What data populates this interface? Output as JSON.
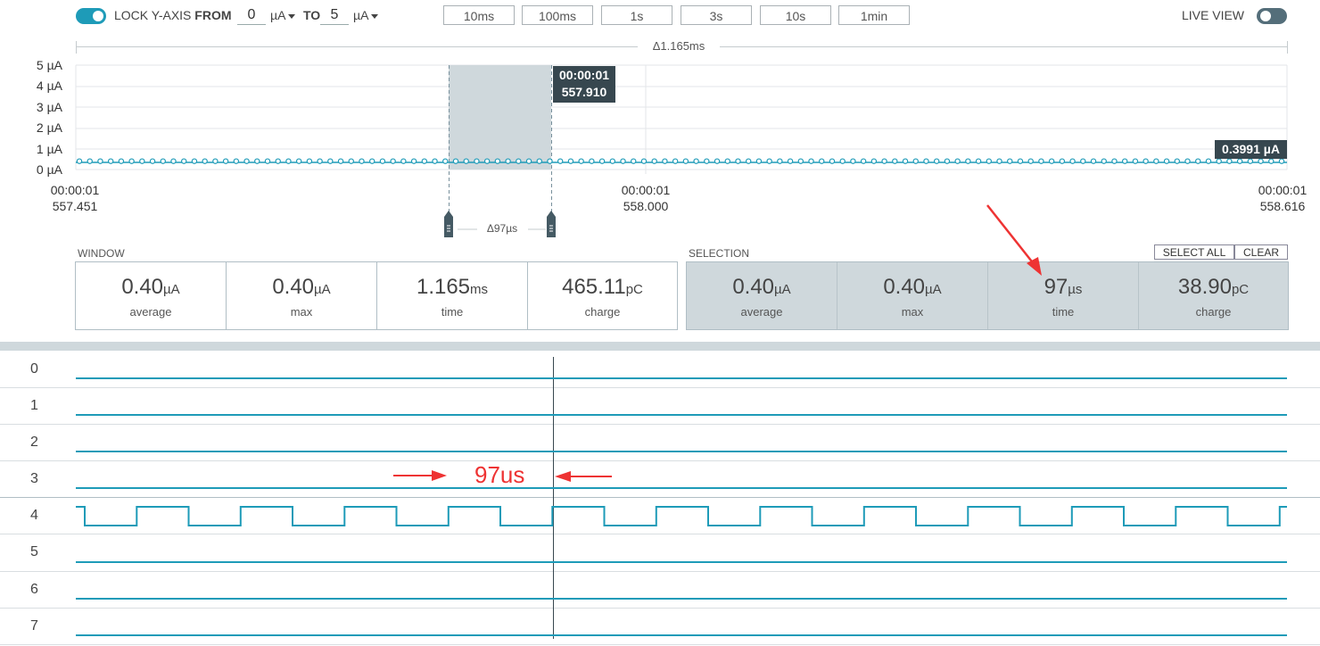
{
  "header": {
    "lock_label": "LOCK Y-AXIS",
    "from_label": "FROM",
    "from_value": "0",
    "from_unit": "µA",
    "to_label": "TO",
    "to_value": "5",
    "to_unit": "µA",
    "live_view_label": "LIVE VIEW",
    "lock_toggle_on": true,
    "live_view_on": false
  },
  "window_buttons": [
    "10ms",
    "100ms",
    "1s",
    "3s",
    "10s",
    "1min"
  ],
  "window_delta": "Δ1.165ms",
  "chart_data": {
    "type": "line",
    "y_tick_labels": [
      "5 µA",
      "4 µA",
      "3 µA",
      "2 µA",
      "1 µA",
      "0 µA"
    ],
    "ylim": [
      0,
      5
    ],
    "x_tick_labels": [
      {
        "line1": "00:00:01",
        "line2": "557.451"
      },
      {
        "line1": "00:00:01",
        "line2": "558.000"
      },
      {
        "line1": "00:00:01",
        "line2": "558.616"
      }
    ],
    "series": [
      {
        "values_uA": 0.3991,
        "points": 116
      }
    ],
    "cursor_tooltip": {
      "line1": "00:00:01",
      "line2": "557.910"
    },
    "value_tooltip": "0.3991 µA",
    "selection_delta": "Δ97µs",
    "line_color": "#1e9bb8",
    "selection_color": "#cfd8dc"
  },
  "window_stats": {
    "title": "WINDOW",
    "items": [
      {
        "value": "0.40",
        "unit": "µA",
        "caption": "average"
      },
      {
        "value": "0.40",
        "unit": "µA",
        "caption": "max"
      },
      {
        "value": "1.165",
        "unit": "ms",
        "caption": "time"
      },
      {
        "value": "465.11",
        "unit": "pC",
        "caption": "charge"
      }
    ]
  },
  "selection_stats": {
    "title": "SELECTION",
    "select_all": "SELECT ALL",
    "clear": "CLEAR",
    "items": [
      {
        "value": "0.40",
        "unit": "µA",
        "caption": "average"
      },
      {
        "value": "0.40",
        "unit": "µA",
        "caption": "max"
      },
      {
        "value": "97",
        "unit": "µs",
        "caption": "time"
      },
      {
        "value": "38.90",
        "unit": "pC",
        "caption": "charge"
      }
    ]
  },
  "digital_channels": {
    "labels": [
      "0",
      "1",
      "2",
      "3",
      "4",
      "5",
      "6",
      "7"
    ],
    "toggling_channel": "4"
  },
  "annotation": {
    "text": "97us",
    "color": "#ee3333"
  }
}
